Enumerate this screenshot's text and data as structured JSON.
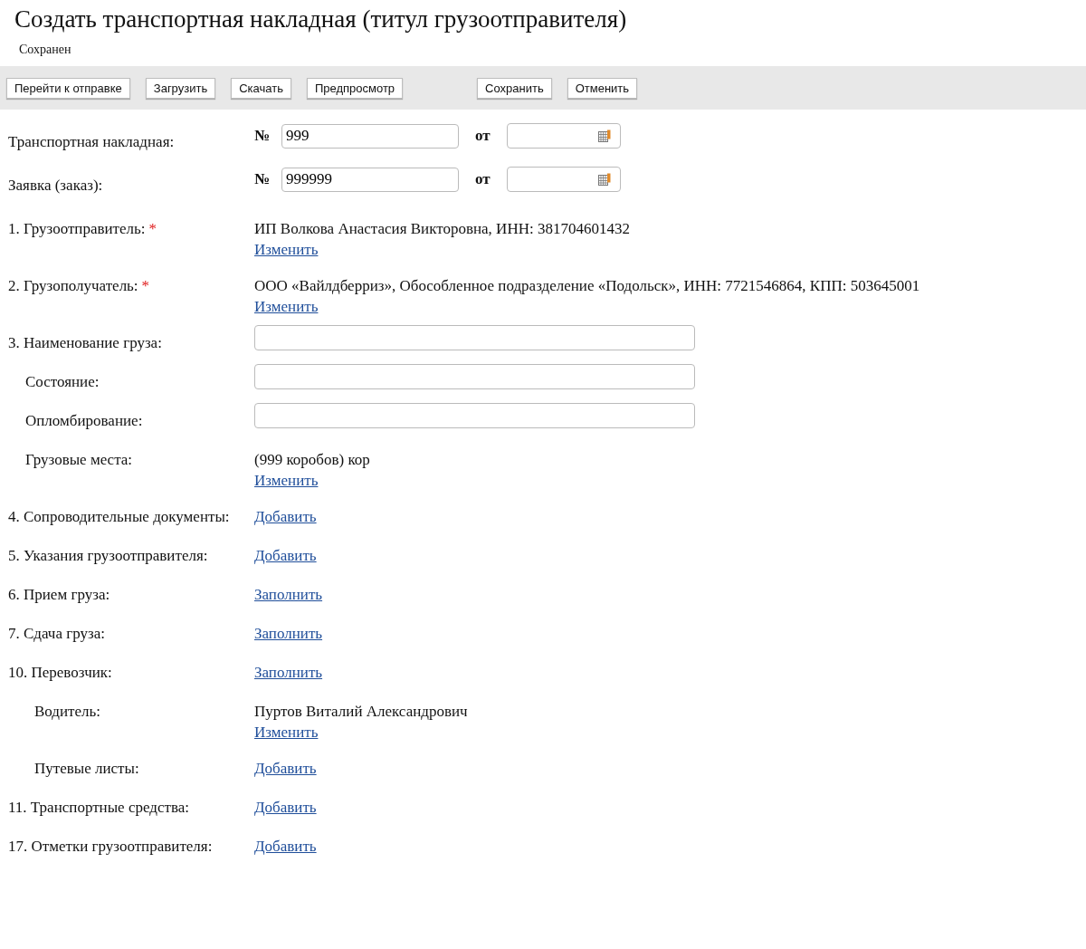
{
  "title": "Создать транспортная накладная (титул грузоотправителя)",
  "status": "Сохранен",
  "toolbar": {
    "left": [
      "Перейти к отправке",
      "Загрузить",
      "Скачать",
      "Предпросмотр"
    ],
    "right": [
      "Сохранить",
      "Отменить"
    ]
  },
  "rows": [
    {
      "kind": "number_date",
      "label": "Транспортная накладная:",
      "number_sign": "№",
      "value": "999",
      "date_label": "от"
    },
    {
      "kind": "number_date",
      "label": "Заявка (заказ):",
      "number_sign": "№",
      "value": "999999",
      "date_label": "от"
    },
    {
      "kind": "text",
      "label": "1. Грузоотправитель:",
      "required_mark": "*",
      "text": "ИП Волкова Анастасия Викторовна, ИНН: 381704601432",
      "link": "Изменить"
    },
    {
      "kind": "text",
      "label": "2. Грузополучатель:",
      "required_mark": "*",
      "text": "ООО «Вайлдберриз», Обособленное подразделение «Подольск», ИНН: 7721546864, КПП: 503645001",
      "link": "Изменить"
    },
    {
      "kind": "input",
      "label": "3. Наименование груза:",
      "children": [
        {
          "kind": "input",
          "label": "Состояние:"
        },
        {
          "kind": "input",
          "label": "Опломбирование:"
        },
        {
          "kind": "text",
          "label": "Грузовые места:",
          "text": "(999 коробов) кор",
          "link": "Изменить"
        }
      ]
    },
    {
      "kind": "link",
      "label": "4. Сопроводительные документы:",
      "link": "Добавить"
    },
    {
      "kind": "link",
      "label": "5. Указания грузоотправителя:",
      "link": "Добавить"
    },
    {
      "kind": "link",
      "label": "6. Прием груза:",
      "link": "Заполнить"
    },
    {
      "kind": "link",
      "label": "7. Сдача груза:",
      "link": "Заполнить"
    },
    {
      "kind": "link",
      "label": "10. Перевозчик:",
      "link": "Заполнить",
      "children": [
        {
          "kind": "text",
          "label": "Водитель:",
          "text": "Пуртов Виталий Александрович",
          "link": "Изменить"
        },
        {
          "kind": "link",
          "label": "Путевые листы:",
          "link": "Добавить"
        }
      ]
    },
    {
      "kind": "link",
      "label": "11. Транспортные средства:",
      "link": "Добавить"
    },
    {
      "kind": "link",
      "label": "17. Отметки грузоотправителя:",
      "link": "Добавить"
    }
  ]
}
